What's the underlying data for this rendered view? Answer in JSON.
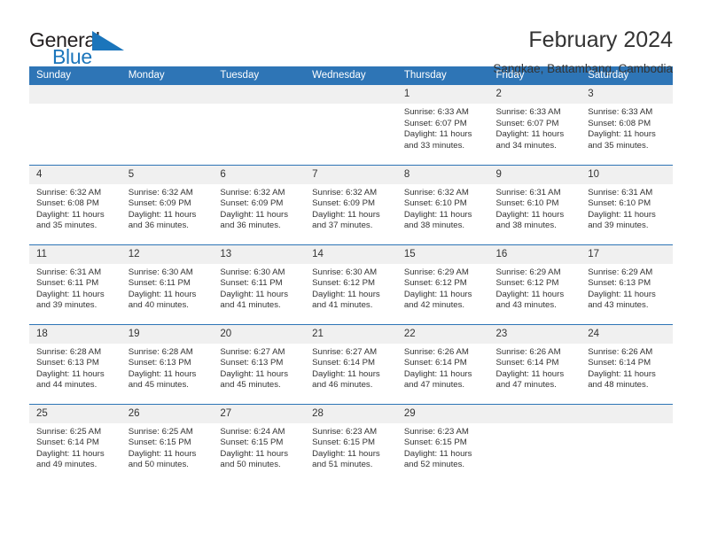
{
  "brand": {
    "name_part1": "General",
    "name_part2": "Blue",
    "accent_color": "#1b75bb"
  },
  "header": {
    "title": "February 2024",
    "subtitle": "Sangkae, Battambang, Cambodia",
    "header_bg_color": "#2e75b6",
    "daynum_bg_color": "#f0f0f0"
  },
  "weekday_headers": [
    "Sunday",
    "Monday",
    "Tuesday",
    "Wednesday",
    "Thursday",
    "Friday",
    "Saturday"
  ],
  "labels": {
    "sunrise_prefix": "Sunrise:",
    "sunset_prefix": "Sunset:",
    "daylight_prefix": "Daylight:"
  },
  "weeks": [
    [
      {
        "day": "",
        "empty": true
      },
      {
        "day": "",
        "empty": true
      },
      {
        "day": "",
        "empty": true
      },
      {
        "day": "",
        "empty": true
      },
      {
        "day": "1",
        "sunrise": "Sunrise: 6:33 AM",
        "sunset": "Sunset: 6:07 PM",
        "daylight_line1": "Daylight: 11 hours",
        "daylight_line2": "and 33 minutes."
      },
      {
        "day": "2",
        "sunrise": "Sunrise: 6:33 AM",
        "sunset": "Sunset: 6:07 PM",
        "daylight_line1": "Daylight: 11 hours",
        "daylight_line2": "and 34 minutes."
      },
      {
        "day": "3",
        "sunrise": "Sunrise: 6:33 AM",
        "sunset": "Sunset: 6:08 PM",
        "daylight_line1": "Daylight: 11 hours",
        "daylight_line2": "and 35 minutes."
      }
    ],
    [
      {
        "day": "4",
        "sunrise": "Sunrise: 6:32 AM",
        "sunset": "Sunset: 6:08 PM",
        "daylight_line1": "Daylight: 11 hours",
        "daylight_line2": "and 35 minutes."
      },
      {
        "day": "5",
        "sunrise": "Sunrise: 6:32 AM",
        "sunset": "Sunset: 6:09 PM",
        "daylight_line1": "Daylight: 11 hours",
        "daylight_line2": "and 36 minutes."
      },
      {
        "day": "6",
        "sunrise": "Sunrise: 6:32 AM",
        "sunset": "Sunset: 6:09 PM",
        "daylight_line1": "Daylight: 11 hours",
        "daylight_line2": "and 36 minutes."
      },
      {
        "day": "7",
        "sunrise": "Sunrise: 6:32 AM",
        "sunset": "Sunset: 6:09 PM",
        "daylight_line1": "Daylight: 11 hours",
        "daylight_line2": "and 37 minutes."
      },
      {
        "day": "8",
        "sunrise": "Sunrise: 6:32 AM",
        "sunset": "Sunset: 6:10 PM",
        "daylight_line1": "Daylight: 11 hours",
        "daylight_line2": "and 38 minutes."
      },
      {
        "day": "9",
        "sunrise": "Sunrise: 6:31 AM",
        "sunset": "Sunset: 6:10 PM",
        "daylight_line1": "Daylight: 11 hours",
        "daylight_line2": "and 38 minutes."
      },
      {
        "day": "10",
        "sunrise": "Sunrise: 6:31 AM",
        "sunset": "Sunset: 6:10 PM",
        "daylight_line1": "Daylight: 11 hours",
        "daylight_line2": "and 39 minutes."
      }
    ],
    [
      {
        "day": "11",
        "sunrise": "Sunrise: 6:31 AM",
        "sunset": "Sunset: 6:11 PM",
        "daylight_line1": "Daylight: 11 hours",
        "daylight_line2": "and 39 minutes."
      },
      {
        "day": "12",
        "sunrise": "Sunrise: 6:30 AM",
        "sunset": "Sunset: 6:11 PM",
        "daylight_line1": "Daylight: 11 hours",
        "daylight_line2": "and 40 minutes."
      },
      {
        "day": "13",
        "sunrise": "Sunrise: 6:30 AM",
        "sunset": "Sunset: 6:11 PM",
        "daylight_line1": "Daylight: 11 hours",
        "daylight_line2": "and 41 minutes."
      },
      {
        "day": "14",
        "sunrise": "Sunrise: 6:30 AM",
        "sunset": "Sunset: 6:12 PM",
        "daylight_line1": "Daylight: 11 hours",
        "daylight_line2": "and 41 minutes."
      },
      {
        "day": "15",
        "sunrise": "Sunrise: 6:29 AM",
        "sunset": "Sunset: 6:12 PM",
        "daylight_line1": "Daylight: 11 hours",
        "daylight_line2": "and 42 minutes."
      },
      {
        "day": "16",
        "sunrise": "Sunrise: 6:29 AM",
        "sunset": "Sunset: 6:12 PM",
        "daylight_line1": "Daylight: 11 hours",
        "daylight_line2": "and 43 minutes."
      },
      {
        "day": "17",
        "sunrise": "Sunrise: 6:29 AM",
        "sunset": "Sunset: 6:13 PM",
        "daylight_line1": "Daylight: 11 hours",
        "daylight_line2": "and 43 minutes."
      }
    ],
    [
      {
        "day": "18",
        "sunrise": "Sunrise: 6:28 AM",
        "sunset": "Sunset: 6:13 PM",
        "daylight_line1": "Daylight: 11 hours",
        "daylight_line2": "and 44 minutes."
      },
      {
        "day": "19",
        "sunrise": "Sunrise: 6:28 AM",
        "sunset": "Sunset: 6:13 PM",
        "daylight_line1": "Daylight: 11 hours",
        "daylight_line2": "and 45 minutes."
      },
      {
        "day": "20",
        "sunrise": "Sunrise: 6:27 AM",
        "sunset": "Sunset: 6:13 PM",
        "daylight_line1": "Daylight: 11 hours",
        "daylight_line2": "and 45 minutes."
      },
      {
        "day": "21",
        "sunrise": "Sunrise: 6:27 AM",
        "sunset": "Sunset: 6:14 PM",
        "daylight_line1": "Daylight: 11 hours",
        "daylight_line2": "and 46 minutes."
      },
      {
        "day": "22",
        "sunrise": "Sunrise: 6:26 AM",
        "sunset": "Sunset: 6:14 PM",
        "daylight_line1": "Daylight: 11 hours",
        "daylight_line2": "and 47 minutes."
      },
      {
        "day": "23",
        "sunrise": "Sunrise: 6:26 AM",
        "sunset": "Sunset: 6:14 PM",
        "daylight_line1": "Daylight: 11 hours",
        "daylight_line2": "and 47 minutes."
      },
      {
        "day": "24",
        "sunrise": "Sunrise: 6:26 AM",
        "sunset": "Sunset: 6:14 PM",
        "daylight_line1": "Daylight: 11 hours",
        "daylight_line2": "and 48 minutes."
      }
    ],
    [
      {
        "day": "25",
        "sunrise": "Sunrise: 6:25 AM",
        "sunset": "Sunset: 6:14 PM",
        "daylight_line1": "Daylight: 11 hours",
        "daylight_line2": "and 49 minutes."
      },
      {
        "day": "26",
        "sunrise": "Sunrise: 6:25 AM",
        "sunset": "Sunset: 6:15 PM",
        "daylight_line1": "Daylight: 11 hours",
        "daylight_line2": "and 50 minutes."
      },
      {
        "day": "27",
        "sunrise": "Sunrise: 6:24 AM",
        "sunset": "Sunset: 6:15 PM",
        "daylight_line1": "Daylight: 11 hours",
        "daylight_line2": "and 50 minutes."
      },
      {
        "day": "28",
        "sunrise": "Sunrise: 6:23 AM",
        "sunset": "Sunset: 6:15 PM",
        "daylight_line1": "Daylight: 11 hours",
        "daylight_line2": "and 51 minutes."
      },
      {
        "day": "29",
        "sunrise": "Sunrise: 6:23 AM",
        "sunset": "Sunset: 6:15 PM",
        "daylight_line1": "Daylight: 11 hours",
        "daylight_line2": "and 52 minutes."
      },
      {
        "day": "",
        "empty": true
      },
      {
        "day": "",
        "empty": true
      }
    ]
  ]
}
